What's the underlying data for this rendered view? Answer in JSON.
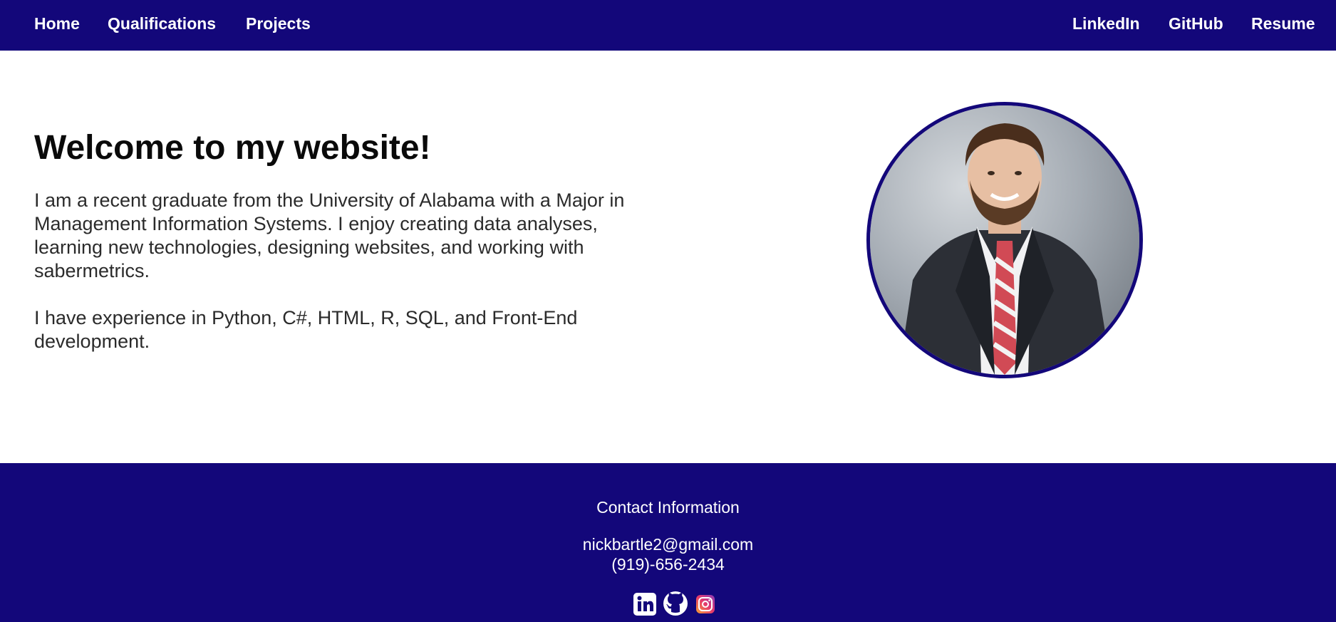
{
  "nav": {
    "left": [
      {
        "label": "Home"
      },
      {
        "label": "Qualifications"
      },
      {
        "label": "Projects"
      }
    ],
    "right": [
      {
        "label": "LinkedIn"
      },
      {
        "label": "GitHub"
      },
      {
        "label": "Resume"
      }
    ]
  },
  "hero": {
    "title": "Welcome to my website!",
    "paragraph1": "I am a recent graduate from the University of Alabama with a Major in Management Information Systems. I enjoy creating data analyses, learning new technologies, designing websites, and working with sabermetrics.",
    "paragraph2": "I have experience in Python, C#, HTML, R, SQL, and Front-End development."
  },
  "footer": {
    "heading": "Contact Information",
    "email": "nickbartle2@gmail.com",
    "phone": "(919)-656-2434",
    "social_icons": [
      "linkedin-icon",
      "github-icon",
      "instagram-icon"
    ]
  },
  "colors": {
    "brand": "#13077a",
    "text": "#2b2b2b",
    "title": "#0a0a0a"
  }
}
